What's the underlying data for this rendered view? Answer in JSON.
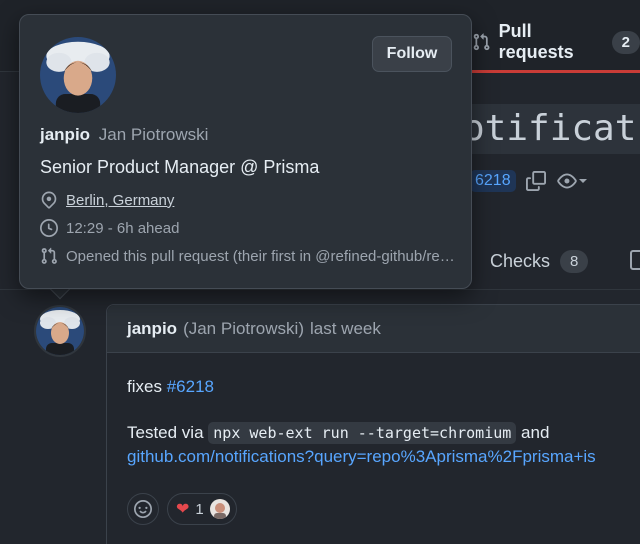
{
  "colors": {
    "background": "#22262d",
    "accent_link": "#58a6ff",
    "tab_underline": "#c93c37",
    "heart": "#e5484d"
  },
  "header_tabs": {
    "pull_requests_label": "Pull requests",
    "pull_requests_count": "2",
    "pull_requests_icon": "git-pull-request-icon"
  },
  "pr": {
    "title_fragment": "otificat",
    "number_link": "6218"
  },
  "tabs": {
    "checks_label": "Checks",
    "checks_count": "8"
  },
  "hovercard": {
    "follow_label": "Follow",
    "login": "janpio",
    "full_name": "Jan Piotrowski",
    "bio": "Senior Product Manager @ Prisma",
    "location": "Berlin, Germany",
    "local_time": "12:29 - 6h ahead",
    "opened_note": "Opened this pull request (their first in @refined-github/refined-github)"
  },
  "comment": {
    "author": "janpio",
    "author_full": "(Jan Piotrowski)",
    "time": "last week",
    "fixes_text": "fixes",
    "fixes_link": "#6218",
    "tested_via": "Tested via",
    "command": "npx web-ext run --target=chromium",
    "and_text": "and",
    "link": "github.com/notifications?query=repo%3Aprisma%2Fprisma+is",
    "reaction_heart_count": "1"
  }
}
